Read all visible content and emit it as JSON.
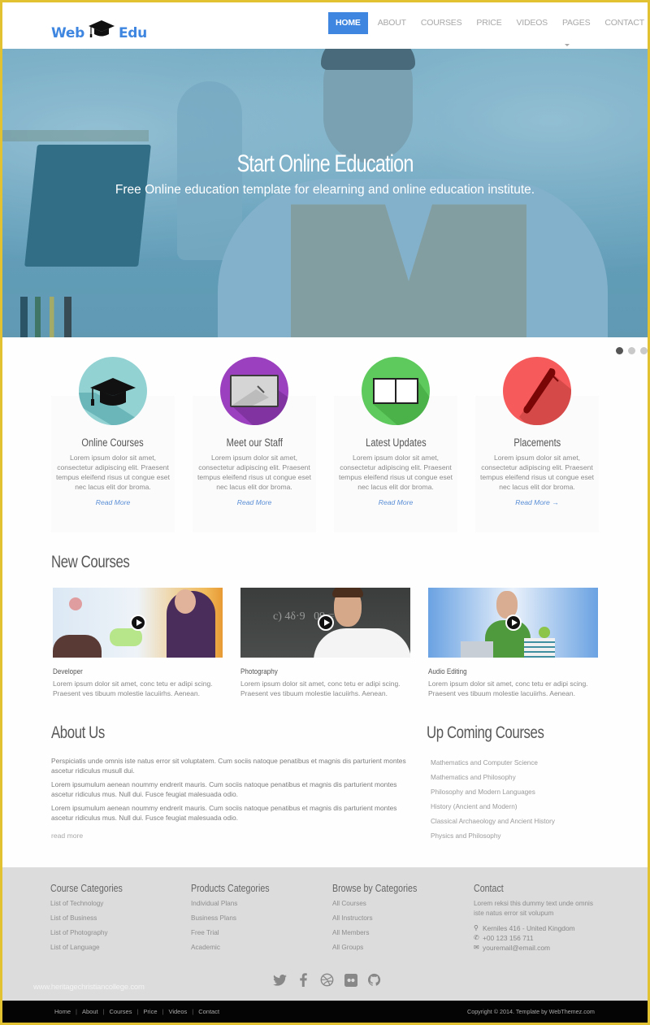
{
  "header": {
    "logo_left": "Web",
    "logo_right": "Edu",
    "logo_icon": "graduation-cap-icon",
    "nav": [
      {
        "label": "HOME",
        "active": true
      },
      {
        "label": "ABOUT",
        "active": false
      },
      {
        "label": "COURSES",
        "active": false
      },
      {
        "label": "PRICE",
        "active": false
      },
      {
        "label": "VIDEOS",
        "active": false
      },
      {
        "label": "PAGES",
        "active": false,
        "dropdown": true
      },
      {
        "label": "CONTACT",
        "active": false
      }
    ]
  },
  "hero": {
    "title": "Start Online Education",
    "subtitle": "Free Online education template for elearning and online education institute.",
    "slides": 3,
    "active_slide": 1
  },
  "features": [
    {
      "title": "Online Courses",
      "icon": "graduation-cap-icon",
      "color": "#8fd0d2",
      "text": "Lorem ipsum dolor sit amet, consectetur adipiscing elit. Praesent tempus eleifend risus ut congue eset nec lacus elit dor broma.",
      "link": "Read More"
    },
    {
      "title": "Meet our Staff",
      "icon": "whiteboard-icon",
      "color": "#9b3fbf",
      "text": "Lorem ipsum dolor sit amet, consectetur adipiscing elit. Praesent tempus eleifend risus ut congue eset nec lacus elit dor broma.",
      "link": "Read More"
    },
    {
      "title": "Latest Updates",
      "icon": "open-book-icon",
      "color": "#5cc85a",
      "text": "Lorem ipsum dolor sit amet, consectetur adipiscing elit. Praesent tempus eleifend risus ut congue eset nec lacus elit dor broma.",
      "link": "Read More"
    },
    {
      "title": "Placements",
      "icon": "pen-icon",
      "color": "#f55a5a",
      "text": "Lorem ipsum dolor sit amet, consectetur adipiscing elit. Praesent tempus eleifend risus ut congue eset nec lacus elit dor broma.",
      "link": "Read More →"
    }
  ],
  "new_courses": {
    "title": "New Courses",
    "items": [
      {
        "title": "Developer",
        "text": "Lorem ipsum dolor sit amet, conc tetu er adipi scing. Praesent ves tibuum molestie lacuiirhs. Aenean."
      },
      {
        "title": "Photography",
        "text": "Lorem ipsum dolor sit amet, conc tetu er adipi scing. Praesent ves tibuum molestie lacuiirhs. Aenean."
      },
      {
        "title": "Audio Editing",
        "text": "Lorem ipsum dolor sit amet, conc tetu er adipi scing. Praesent ves tibuum molestie lacuiirhs. Aenean."
      }
    ]
  },
  "about": {
    "title": "About Us",
    "paragraphs": [
      "Perspiciatis unde omnis iste natus error sit voluptatem. Cum sociis natoque penatibus et magnis dis parturient montes ascetur ridiculus musull dui.",
      "Lorem ipsumulum aenean noummy endrerit mauris. Cum sociis natoque penatibus et magnis dis parturient montes ascetur ridiculus mus. Null dui. Fusce feugiat malesuada odio.",
      "Lorem ipsumulum aenean noummy endrerit mauris. Cum sociis natoque penatibus et magnis dis parturient montes ascetur ridiculus mus. Null dui. Fusce feugiat malesuada odio."
    ],
    "read_more": "read more"
  },
  "upcoming": {
    "title": "Up Coming Courses",
    "items": [
      "Mathematics and Computer Science",
      "Mathematics and Philosophy",
      "Philosophy and Modern Languages",
      "History (Ancient and Modern)",
      "Classical Archaeology and Ancient History",
      "Physics and Philosophy"
    ]
  },
  "footer": {
    "columns": [
      {
        "title": "Course Categories",
        "links": [
          "List of Technology",
          "List of Business",
          "List of Photography",
          "List of Language"
        ]
      },
      {
        "title": "Products Categories",
        "links": [
          "Individual Plans",
          "Business Plans",
          "Free Trial",
          "Academic"
        ]
      },
      {
        "title": "Browse by Categories",
        "links": [
          "All Courses",
          "All Instructors",
          "All Members",
          "All Groups"
        ]
      }
    ],
    "contact": {
      "title": "Contact",
      "text": "Lorem reksi this dummy text unde omnis iste natus error sit volupum",
      "address": "Kerniles 416 - United Kingdom",
      "phone": "+00 123 156 711",
      "email": "youremail@email.com"
    },
    "watermark": "www.heritagechristiancollege.com",
    "social": [
      "twitter-icon",
      "facebook-icon",
      "dribbble-icon",
      "flickr-icon",
      "github-icon"
    ],
    "bottom_nav": [
      "Home",
      "About",
      "Courses",
      "Price",
      "Videos",
      "Contact"
    ],
    "copyright": "Copyright © 2014. Template by   WebThemez.com"
  }
}
